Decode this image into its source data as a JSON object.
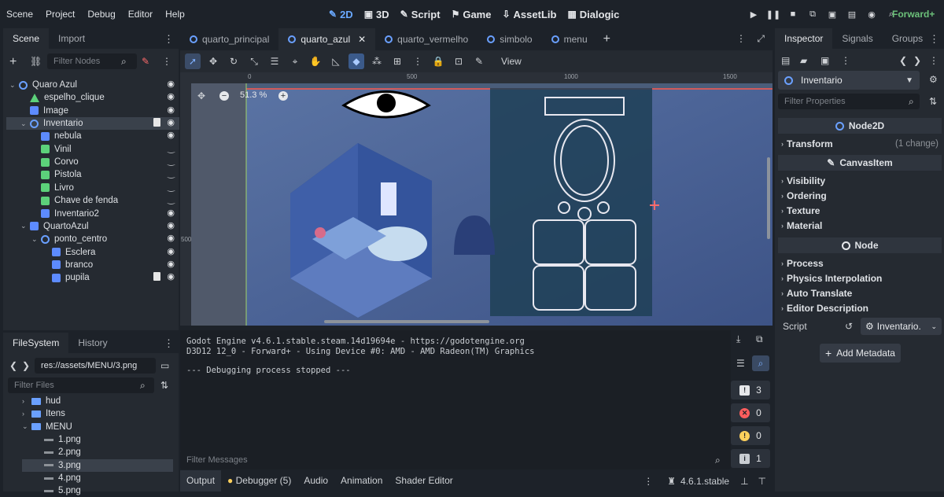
{
  "menu": [
    "Scene",
    "Project",
    "Debug",
    "Editor",
    "Help"
  ],
  "workspaces": [
    {
      "icon": "✎",
      "label": "2D",
      "active": true
    },
    {
      "icon": "▣",
      "label": "3D"
    },
    {
      "icon": "✎",
      "label": "Script"
    },
    {
      "icon": "⚑",
      "label": "Game"
    },
    {
      "icon": "⇩",
      "label": "AssetLib"
    },
    {
      "icon": "▦",
      "label": "Dialogic"
    }
  ],
  "renderer": "Forward+",
  "scene_panel": {
    "tabs": [
      "Scene",
      "Import"
    ],
    "filter_placeholder": "Filter Nodes",
    "nodes": [
      {
        "name": "Quaro Azul",
        "type": "node2d",
        "depth": 0,
        "vis": "visible"
      },
      {
        "name": "espelho_clique",
        "type": "area",
        "depth": 1,
        "vis": "visible"
      },
      {
        "name": "Image",
        "type": "sprite",
        "depth": 1,
        "vis": "visible"
      },
      {
        "name": "Inventario",
        "type": "node2d",
        "depth": 1,
        "vis": "visible",
        "selected": true,
        "script": true
      },
      {
        "name": "nebula",
        "type": "sprite",
        "depth": 2,
        "vis": "visible"
      },
      {
        "name": "Vinil",
        "type": "area",
        "depth": 2,
        "vis": "hidden"
      },
      {
        "name": "Corvo",
        "type": "area",
        "depth": 2,
        "vis": "hidden"
      },
      {
        "name": "Pistola",
        "type": "area",
        "depth": 2,
        "vis": "hidden"
      },
      {
        "name": "Livro",
        "type": "area",
        "depth": 2,
        "vis": "hidden"
      },
      {
        "name": "Chave de fenda",
        "type": "area",
        "depth": 2,
        "vis": "hidden"
      },
      {
        "name": "Inventario2",
        "type": "sprite",
        "depth": 2,
        "vis": "visible"
      },
      {
        "name": "QuartoAzul",
        "type": "sprite",
        "depth": 1,
        "vis": "visible"
      },
      {
        "name": "ponto_centro",
        "type": "node2d",
        "depth": 2,
        "vis": "visible"
      },
      {
        "name": "Esclera",
        "type": "sprite",
        "depth": 3,
        "vis": "visible"
      },
      {
        "name": "branco",
        "type": "sprite",
        "depth": 3,
        "vis": "visible"
      },
      {
        "name": "pupila",
        "type": "sprite",
        "depth": 3,
        "vis": "visible",
        "script": true
      }
    ]
  },
  "filesystem": {
    "tabs": [
      "FileSystem",
      "History"
    ],
    "path": "res://assets/MENU/3.png",
    "filter_placeholder": "Filter Files",
    "items": [
      {
        "name": "hud",
        "type": "folder",
        "depth": 1
      },
      {
        "name": "Itens",
        "type": "folder",
        "depth": 1
      },
      {
        "name": "MENU",
        "type": "folder",
        "depth": 1,
        "open": true
      },
      {
        "name": "1.png",
        "type": "file",
        "depth": 2
      },
      {
        "name": "2.png",
        "type": "file",
        "depth": 2
      },
      {
        "name": "3.png",
        "type": "file",
        "depth": 2,
        "selected": true
      },
      {
        "name": "4.png",
        "type": "file",
        "depth": 2
      },
      {
        "name": "5.png",
        "type": "file",
        "depth": 2
      }
    ]
  },
  "editor_tabs": [
    {
      "label": "quarto_principal"
    },
    {
      "label": "quarto_azul",
      "active": true
    },
    {
      "label": "quarto_vermelho"
    },
    {
      "label": "simbolo"
    },
    {
      "label": "menu"
    }
  ],
  "toolbar": {
    "view_label": "View"
  },
  "viewport": {
    "zoom": "51.3 %",
    "ruler_marks": [
      "0",
      "500",
      "1000",
      "1500"
    ],
    "vruler_mark": "500"
  },
  "output": {
    "lines": [
      "Godot Engine v4.6.1.stable.steam.14d19694e - https://godotengine.org",
      "D3D12 12_0 - Forward+ - Using Device #0: AMD - AMD Radeon(TM) Graphics",
      "",
      "--- Debugging process stopped ---"
    ],
    "filter_placeholder": "Filter Messages",
    "counts": {
      "messages": "3",
      "errors": "0",
      "warnings": "0",
      "info": "1"
    }
  },
  "bottom_tabs": [
    "Output",
    "Debugger (5)",
    "Audio",
    "Animation",
    "Shader Editor"
  ],
  "version": "4.6.1.stable",
  "inspector": {
    "tabs": [
      "Inspector",
      "Signals",
      "Groups"
    ],
    "node_name": "Inventario",
    "filter_placeholder": "Filter Properties",
    "sections": {
      "node2d": "Node2D",
      "canvasitem": "CanvasItem",
      "node": "Node"
    },
    "transform": {
      "label": "Transform",
      "extra": "(1 change)"
    },
    "canvas_props": [
      "Visibility",
      "Ordering",
      "Texture",
      "Material"
    ],
    "node_props": [
      "Process",
      "Physics Interpolation",
      "Auto Translate",
      "Editor Description"
    ],
    "script_label": "Script",
    "script_value": "Inventario.",
    "add_metadata": "Add Metadata"
  },
  "colors": {
    "accent": "#6aa9ff",
    "renderer": "#6cc17a",
    "bg": "#1d2229"
  }
}
